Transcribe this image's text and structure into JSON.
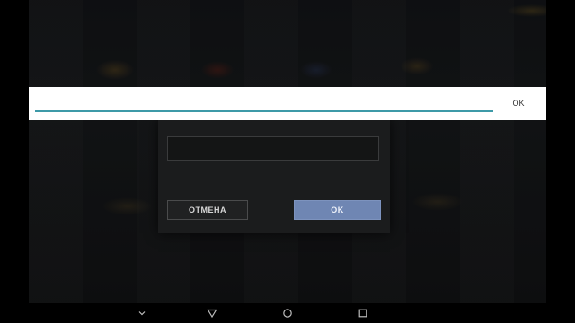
{
  "game_dialog": {
    "input_value": "",
    "cancel_label": "ОТМЕНА",
    "ok_label": "OK"
  },
  "ime_extract": {
    "input_value": "",
    "action_label": "OK"
  },
  "nav_bar": {
    "buttons": [
      {
        "name": "hide-keyboard",
        "icon": "chevron-down-icon"
      },
      {
        "name": "back",
        "icon": "back-triangle-icon"
      },
      {
        "name": "home",
        "icon": "home-circle-icon"
      },
      {
        "name": "recents",
        "icon": "recents-square-icon"
      }
    ]
  },
  "colors": {
    "ok_button": "#6f86b3",
    "ime_underline": "#3e9aa8",
    "dialog_bg": "#1b1c1d"
  }
}
